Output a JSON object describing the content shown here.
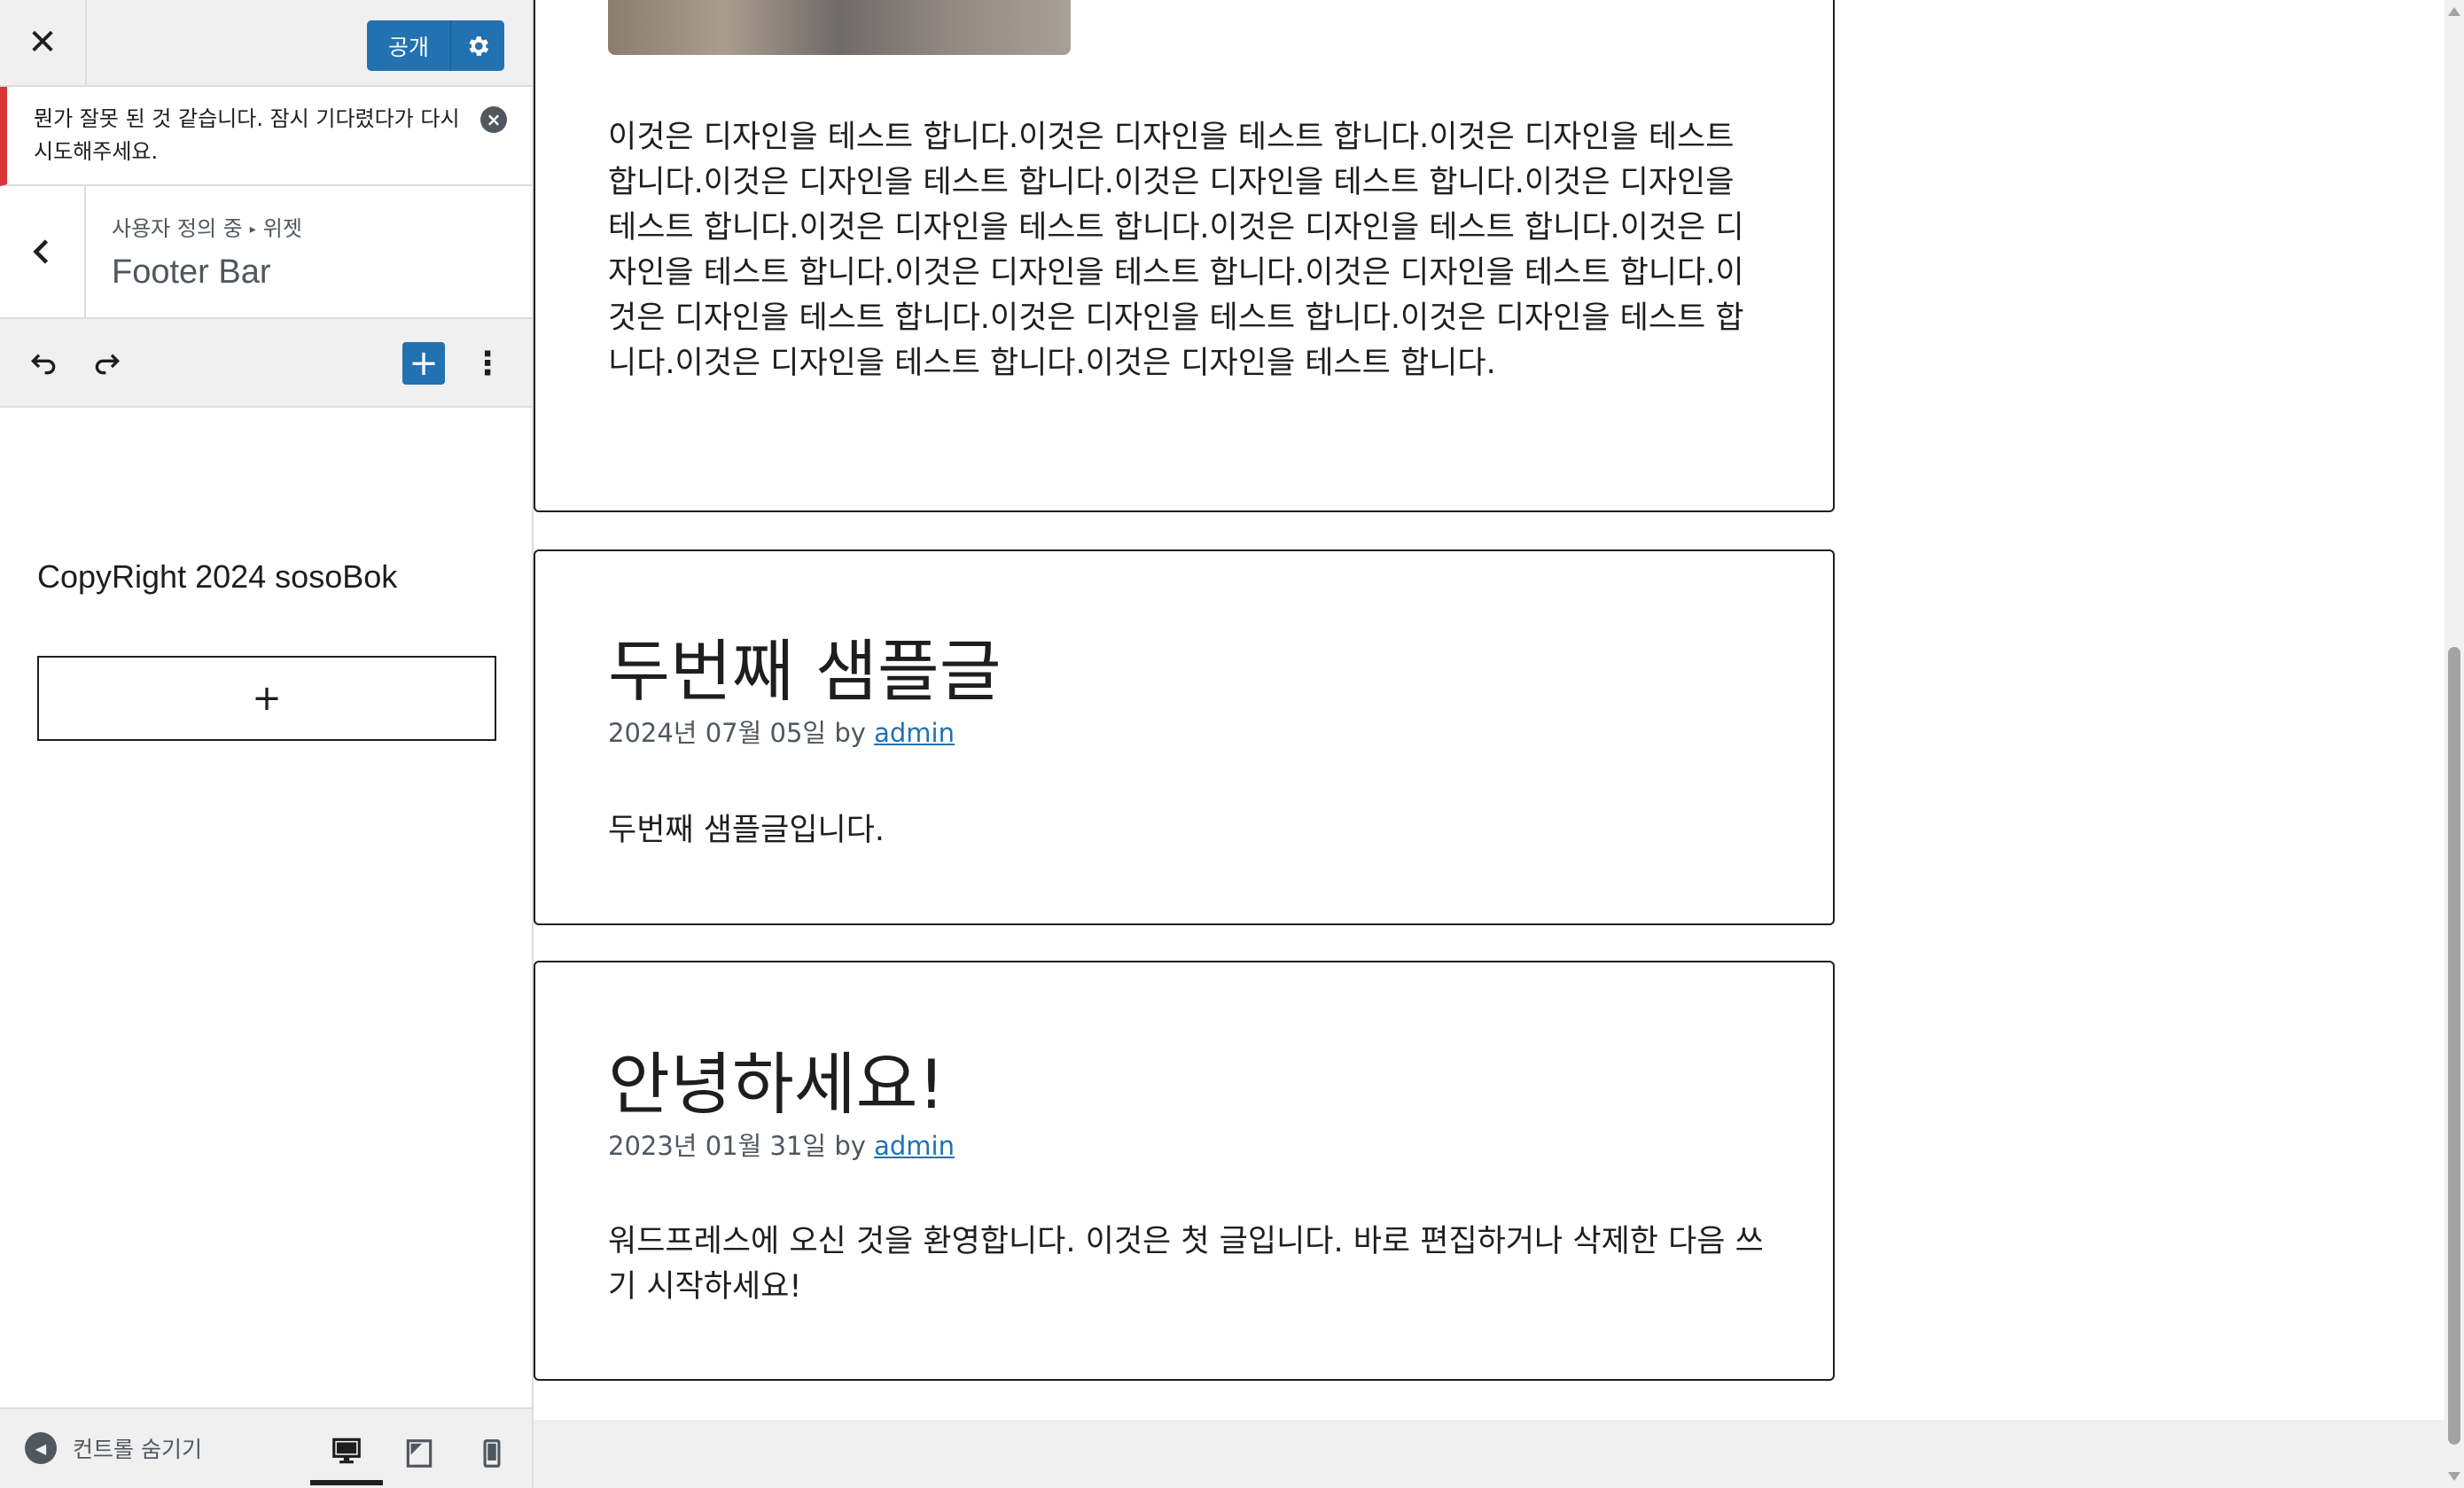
{
  "topbar": {
    "close_icon": "close-icon",
    "publish_label": "공개",
    "publish_settings_icon": "gear-icon"
  },
  "notice": {
    "text": "뭔가 잘못 된 것 같습니다. 잠시 기다렸다가 다시 시도해주세요.",
    "dismiss_icon": "dismiss-icon",
    "accent_color": "#d63638"
  },
  "section": {
    "breadcrumb_root": "사용자 정의 중",
    "breadcrumb_sep": "▸",
    "breadcrumb_leaf": "위젯",
    "title": "Footer Bar"
  },
  "toolbar": {
    "undo_icon": "undo-icon",
    "redo_icon": "redo-icon",
    "add_label": "+",
    "more_label": "⋮"
  },
  "widget": {
    "copyright": "CopyRight 2024 sosoBok",
    "appender_label": "+"
  },
  "footer": {
    "collapse_label": "컨트롤 숨기기",
    "devices": [
      "desktop",
      "tablet",
      "mobile"
    ],
    "active_device": "desktop"
  },
  "posts": [
    {
      "body": "이것은 디자인을 테스트 합니다.이것은 디자인을 테스트 합니다.이것은 디자인을 테스트 합니다.이것은 디자인을 테스트 합니다.이것은 디자인을 테스트 합니다.이것은 디자인을 테스트 합니다.이것은 디자인을 테스트 합니다.이것은 디자인을 테스트 합니다.이것은 디자인을 테스트 합니다.이것은 디자인을 테스트 합니다.이것은 디자인을 테스트 합니다.이것은 디자인을 테스트 합니다.이것은 디자인을 테스트 합니다.이것은 디자인을 테스트 합니다.이것은 디자인을 테스트 합니다.이것은 디자인을 테스트 합니다."
    },
    {
      "title": "두번째 샘플글",
      "date": "2024년 07월 05일",
      "by": "by",
      "author": "admin",
      "body": "두번째 샘플글입니다."
    },
    {
      "title": "안녕하세요!",
      "date": "2023년 01월 31일",
      "by": "by",
      "author": "admin",
      "body": "워드프레스에 오신 것을 환영합니다. 이것은 첫 글입니다. 바로 편집하거나 삭제한 다음 쓰기 시작하세요!"
    }
  ],
  "colors": {
    "primary": "#2271b1",
    "link": "#2271b1",
    "error": "#d63638"
  }
}
